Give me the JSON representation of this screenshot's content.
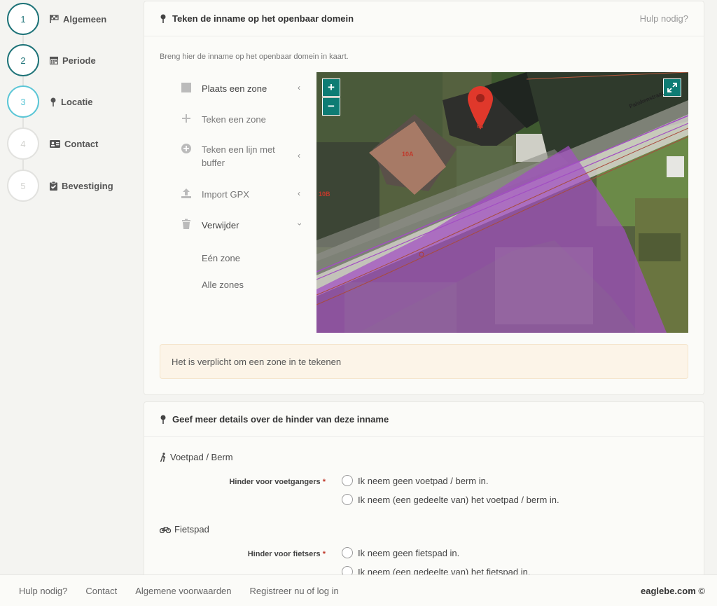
{
  "steps": [
    {
      "number": "1",
      "label": "Algemeen",
      "icon": "flag-icon",
      "state": "done"
    },
    {
      "number": "2",
      "label": "Periode",
      "icon": "calendar-icon",
      "state": "done"
    },
    {
      "number": "3",
      "label": "Locatie",
      "icon": "map-pin-icon",
      "state": "active"
    },
    {
      "number": "4",
      "label": "Contact",
      "icon": "id-card-icon",
      "state": "future"
    },
    {
      "number": "5",
      "label": "Bevestiging",
      "icon": "clipboard-check-icon",
      "state": "future"
    }
  ],
  "location_card": {
    "title": "Teken de inname op het openbaar domein",
    "help_link": "Hulp nodig?",
    "intro": "Breng hier de inname op het openbaar domein in kaart.",
    "tools": [
      {
        "label": "Plaats een zone",
        "icon": "square-icon",
        "has_chevron": true
      },
      {
        "label": "Teken een zone",
        "icon": "plus-icon",
        "has_chevron": false
      },
      {
        "label": "Teken een lijn met buffer",
        "icon": "plus-circle-icon",
        "has_chevron": true
      },
      {
        "label": "Import GPX",
        "icon": "upload-icon",
        "has_chevron": true
      },
      {
        "label": "Verwijder",
        "icon": "trash-icon",
        "has_chevron": true,
        "expanded": true
      }
    ],
    "delete_options": [
      "Eén zone",
      "Alle zones"
    ],
    "map": {
      "zoom_in": "+",
      "zoom_out": "−",
      "street_label": "Palokenstraat",
      "house_labels": [
        "10A",
        "10B"
      ],
      "marker_label": "6a",
      "accent_color": "#0e7c74",
      "zone_color": "#a24ec2",
      "marker_color": "#e0382b"
    },
    "alert": "Het is verplicht om een zone in te tekenen"
  },
  "details_card": {
    "title": "Geef meer details over de hinder van deze inname",
    "sections": [
      {
        "title": "Voetpad / Berm",
        "icon": "pedestrian-icon",
        "field_label": "Hinder voor voetgangers",
        "required_mark": "*",
        "options": [
          "Ik neem geen voetpad / berm in.",
          "Ik neem (een gedeelte van) het voetpad / berm in."
        ]
      },
      {
        "title": "Fietspad",
        "icon": "bicycle-icon",
        "field_label": "Hinder voor fietsers",
        "required_mark": "*",
        "options": [
          "Ik neem geen fietspad in.",
          "Ik neem (een gedeelte van) het fietspad in."
        ]
      }
    ]
  },
  "footer": {
    "links": [
      "Hulp nodig?",
      "Contact",
      "Algemene voorwaarden",
      "Registreer nu of log in"
    ],
    "brand": "eaglebe.com",
    "copyright": "©"
  }
}
